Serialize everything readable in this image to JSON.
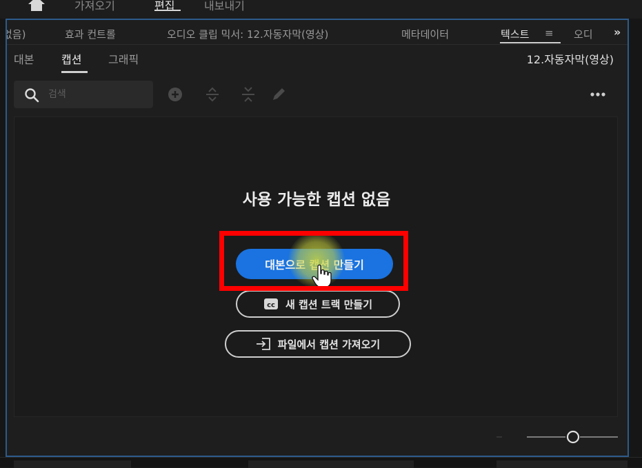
{
  "workspace_nav": {
    "items": [
      {
        "label": "가져오기",
        "active": false
      },
      {
        "label": "편집",
        "active": true
      },
      {
        "label": "내보내기",
        "active": false
      }
    ]
  },
  "panel_tabs": {
    "items": [
      {
        "label": "없음)",
        "active": false
      },
      {
        "label": "효과 컨트롤",
        "active": false
      },
      {
        "label": "오디오 클립 믹서: 12.자동자막(영상)",
        "active": false
      },
      {
        "label": "메타데이터",
        "active": false
      },
      {
        "label": "텍스트",
        "active": true
      },
      {
        "label": "≡",
        "active": false
      },
      {
        "label": "오디",
        "active": false
      }
    ],
    "overflow_label": "»"
  },
  "subtabs": {
    "items": [
      {
        "label": "대본",
        "active": false
      },
      {
        "label": "캡션",
        "active": true
      },
      {
        "label": "그래픽",
        "active": false
      }
    ],
    "sequence_name": "12.자동자막(영상)"
  },
  "toolbar": {
    "search_placeholder": "검색",
    "icons": [
      "search-icon",
      "add-icon",
      "split-icon",
      "merge-icon",
      "pencil-icon",
      "more-icon"
    ]
  },
  "empty_state": {
    "title": "사용 가능한 캡션 없음",
    "primary_button": "대본으로 캡션 만들기",
    "new_track_button": "새 캡션 트랙 만들기",
    "import_button": "파일에서 캡션 가져오기"
  },
  "colors": {
    "accent": "#1a73e0",
    "panel_border": "#2d5b8c",
    "highlight": "#ff0000"
  }
}
